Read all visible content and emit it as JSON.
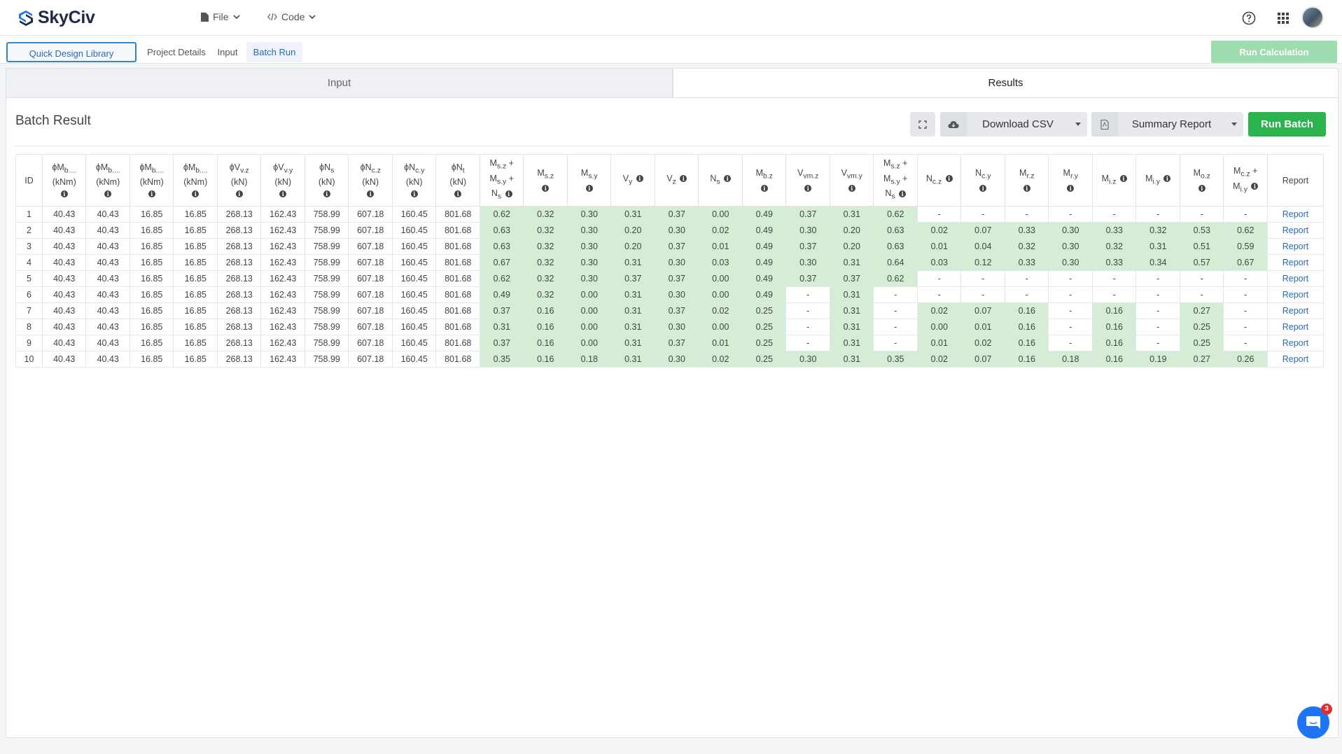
{
  "app": {
    "name": "SkyCiv"
  },
  "topbar": {
    "file_label": "File",
    "code_label": "Code",
    "help_icon": "help-circle-icon",
    "apps_icon": "grid-apps-icon"
  },
  "subnav": {
    "tabs": [
      {
        "label": "Quick Design Library"
      },
      {
        "label": "Project Details"
      },
      {
        "label": "Input"
      },
      {
        "label": "Batch Run"
      }
    ],
    "run_calculation": "Run Calculation"
  },
  "panel_tabs": {
    "input": "Input",
    "results": "Results"
  },
  "batch": {
    "title": "Batch Result",
    "download_csv": "Download CSV",
    "summary_report": "Summary Report",
    "run_batch": "Run Batch"
  },
  "colors": {
    "accent_green": "#2bb34e",
    "pass_cell": "#d5ecd5",
    "link_blue": "#2a6bb0"
  },
  "table": {
    "headers": [
      {
        "html": "ID",
        "info": false
      },
      {
        "html": "ϕM<sub>b....</sub><br>(kNm)",
        "info": true
      },
      {
        "html": "ϕM<sub>b....</sub><br>(kNm)",
        "info": true
      },
      {
        "html": "ϕM<sub>b....</sub><br>(kNm)",
        "info": true
      },
      {
        "html": "ϕM<sub>b....</sub><br>(kNm)",
        "info": true
      },
      {
        "html": "ϕV<sub>v.z</sub><br>(kN)",
        "info": true
      },
      {
        "html": "ϕV<sub>v.y</sub><br>(kN)",
        "info": true
      },
      {
        "html": "ϕN<sub>s</sub><br>(kN)",
        "info": true
      },
      {
        "html": "ϕN<sub>c.z</sub><br>(kN)",
        "info": true
      },
      {
        "html": "ϕN<sub>c.y</sub><br>(kN)",
        "info": true
      },
      {
        "html": "ϕN<sub>t</sub><br>(kN)",
        "info": true
      },
      {
        "html": "M<sub>s.z</sub> +<br>M<sub>s.y</sub> +<br>N<sub>s</sub>",
        "info": true,
        "inline": true
      },
      {
        "html": "M<sub>s.z</sub>",
        "info": true
      },
      {
        "html": "M<sub>s.y</sub>",
        "info": true
      },
      {
        "html": "V<sub>y</sub>",
        "info": true,
        "inline": true
      },
      {
        "html": "V<sub>z</sub>",
        "info": true,
        "inline": true
      },
      {
        "html": "N<sub>s</sub>",
        "info": true,
        "inline": true
      },
      {
        "html": "M<sub>b.z</sub>",
        "info": true
      },
      {
        "html": "V<sub>vm.z</sub>",
        "info": true
      },
      {
        "html": "V<sub>vm.y</sub>",
        "info": true
      },
      {
        "html": "M<sub>s.z</sub> +<br>M<sub>s.y</sub> +<br>N<sub>s</sub>",
        "info": true,
        "inline": true
      },
      {
        "html": "N<sub>c.z</sub>",
        "info": true,
        "inline": true
      },
      {
        "html": "N<sub>c.y</sub>",
        "info": true
      },
      {
        "html": "M<sub>r.z</sub>",
        "info": true
      },
      {
        "html": "M<sub>r.y</sub>",
        "info": true
      },
      {
        "html": "M<sub>i.z</sub>",
        "info": true,
        "inline": true
      },
      {
        "html": "M<sub>i.y</sub>",
        "info": true,
        "inline": true
      },
      {
        "html": "M<sub>o.z</sub>",
        "info": true
      },
      {
        "html": "M<sub>c.z</sub> +<br>M<sub>i.y</sub>",
        "info": true,
        "inline": true
      },
      {
        "html": "Report",
        "info": false
      }
    ],
    "rows": [
      [
        "1",
        "40.43",
        "40.43",
        "16.85",
        "16.85",
        "268.13",
        "162.43",
        "758.99",
        "607.18",
        "160.45",
        "801.68",
        "0.62",
        "0.32",
        "0.30",
        "0.31",
        "0.37",
        "0.00",
        "0.49",
        "0.37",
        "0.31",
        "0.62",
        "-",
        "-",
        "-",
        "-",
        "-",
        "-",
        "-",
        "-",
        "Report"
      ],
      [
        "2",
        "40.43",
        "40.43",
        "16.85",
        "16.85",
        "268.13",
        "162.43",
        "758.99",
        "607.18",
        "160.45",
        "801.68",
        "0.63",
        "0.32",
        "0.30",
        "0.20",
        "0.30",
        "0.02",
        "0.49",
        "0.30",
        "0.20",
        "0.63",
        "0.02",
        "0.07",
        "0.33",
        "0.30",
        "0.33",
        "0.32",
        "0.53",
        "0.62",
        "Report"
      ],
      [
        "3",
        "40.43",
        "40.43",
        "16.85",
        "16.85",
        "268.13",
        "162.43",
        "758.99",
        "607.18",
        "160.45",
        "801.68",
        "0.63",
        "0.32",
        "0.30",
        "0.20",
        "0.37",
        "0.01",
        "0.49",
        "0.37",
        "0.20",
        "0.63",
        "0.01",
        "0.04",
        "0.32",
        "0.30",
        "0.32",
        "0.31",
        "0.51",
        "0.59",
        "Report"
      ],
      [
        "4",
        "40.43",
        "40.43",
        "16.85",
        "16.85",
        "268.13",
        "162.43",
        "758.99",
        "607.18",
        "160.45",
        "801.68",
        "0.67",
        "0.32",
        "0.30",
        "0.31",
        "0.30",
        "0.03",
        "0.49",
        "0.30",
        "0.31",
        "0.64",
        "0.03",
        "0.12",
        "0.33",
        "0.30",
        "0.33",
        "0.34",
        "0.57",
        "0.67",
        "Report"
      ],
      [
        "5",
        "40.43",
        "40.43",
        "16.85",
        "16.85",
        "268.13",
        "162.43",
        "758.99",
        "607.18",
        "160.45",
        "801.68",
        "0.62",
        "0.32",
        "0.30",
        "0.37",
        "0.37",
        "0.00",
        "0.49",
        "0.37",
        "0.37",
        "0.62",
        "-",
        "-",
        "-",
        "-",
        "-",
        "-",
        "-",
        "-",
        "Report"
      ],
      [
        "6",
        "40.43",
        "40.43",
        "16.85",
        "16.85",
        "268.13",
        "162.43",
        "758.99",
        "607.18",
        "160.45",
        "801.68",
        "0.49",
        "0.32",
        "0.00",
        "0.31",
        "0.30",
        "0.00",
        "0.49",
        "-",
        "0.31",
        "-",
        "-",
        "-",
        "-",
        "-",
        "-",
        "-",
        "-",
        "-",
        "Report"
      ],
      [
        "7",
        "40.43",
        "40.43",
        "16.85",
        "16.85",
        "268.13",
        "162.43",
        "758.99",
        "607.18",
        "160.45",
        "801.68",
        "0.37",
        "0.16",
        "0.00",
        "0.31",
        "0.37",
        "0.02",
        "0.25",
        "-",
        "0.31",
        "-",
        "0.02",
        "0.07",
        "0.16",
        "-",
        "0.16",
        "-",
        "0.27",
        "-",
        "Report"
      ],
      [
        "8",
        "40.43",
        "40.43",
        "16.85",
        "16.85",
        "268.13",
        "162.43",
        "758.99",
        "607.18",
        "160.45",
        "801.68",
        "0.31",
        "0.16",
        "0.00",
        "0.31",
        "0.30",
        "0.00",
        "0.25",
        "-",
        "0.31",
        "-",
        "0.00",
        "0.01",
        "0.16",
        "-",
        "0.16",
        "-",
        "0.25",
        "-",
        "Report"
      ],
      [
        "9",
        "40.43",
        "40.43",
        "16.85",
        "16.85",
        "268.13",
        "162.43",
        "758.99",
        "607.18",
        "160.45",
        "801.68",
        "0.37",
        "0.16",
        "0.00",
        "0.31",
        "0.37",
        "0.01",
        "0.25",
        "-",
        "0.31",
        "-",
        "0.01",
        "0.02",
        "0.16",
        "-",
        "0.16",
        "-",
        "0.25",
        "-",
        "Report"
      ],
      [
        "10",
        "40.43",
        "40.43",
        "16.85",
        "16.85",
        "268.13",
        "162.43",
        "758.99",
        "607.18",
        "160.45",
        "801.68",
        "0.35",
        "0.16",
        "0.18",
        "0.31",
        "0.30",
        "0.02",
        "0.25",
        "0.30",
        "0.31",
        "0.35",
        "0.02",
        "0.07",
        "0.16",
        "0.18",
        "0.16",
        "0.19",
        "0.27",
        "0.26",
        "Report"
      ]
    ]
  },
  "chat": {
    "badge_count": "3"
  }
}
